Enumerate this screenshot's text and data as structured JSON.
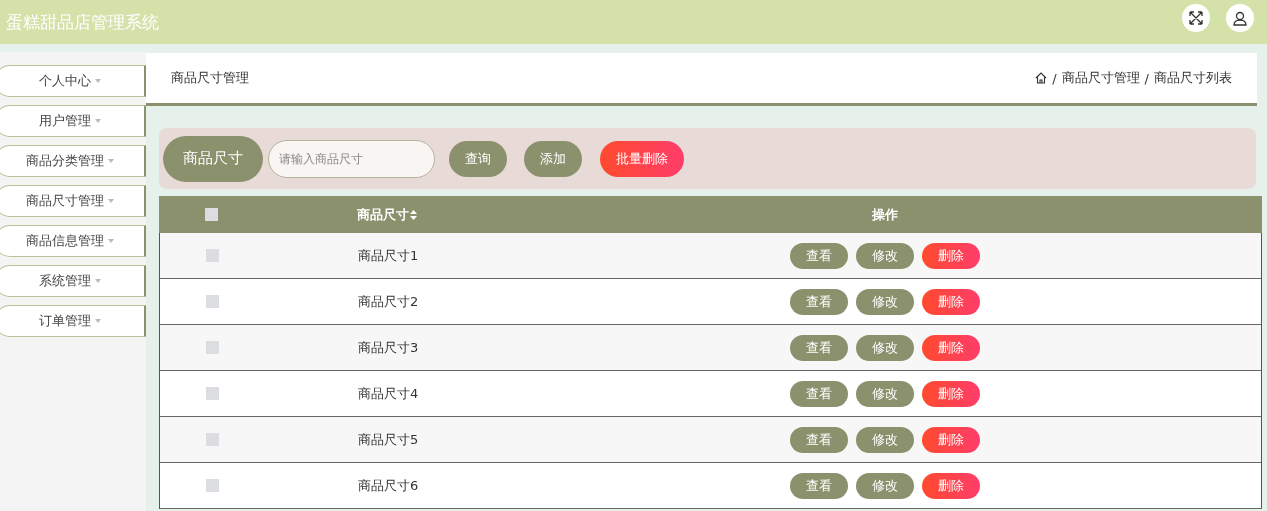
{
  "header": {
    "title": "蛋糕甜品店管理系统"
  },
  "sidebar": {
    "items": [
      {
        "label": "个人中心",
        "selected": false
      },
      {
        "label": "用户管理",
        "selected": false
      },
      {
        "label": "商品分类管理",
        "selected": false
      },
      {
        "label": "商品尺寸管理",
        "selected": false
      },
      {
        "label": "商品信息管理",
        "selected": false
      },
      {
        "label": "系统管理",
        "selected": false
      },
      {
        "label": "订单管理",
        "selected": false
      }
    ]
  },
  "page_title": "商品尺寸管理",
  "breadcrumb": [
    {
      "separator": "/",
      "label": "商品尺寸管理"
    },
    {
      "separator": "/",
      "label": "商品尺寸列表"
    }
  ],
  "search": {
    "label": "商品尺寸",
    "placeholder": "请输入商品尺寸",
    "buttons": [
      {
        "label": "查询",
        "kind": "normal"
      },
      {
        "label": "添加",
        "kind": "normal"
      },
      {
        "label": "批量删除",
        "kind": "danger"
      }
    ]
  },
  "table": {
    "select_all": {
      "checked": false
    },
    "columns": [
      "商品尺寸",
      "操作"
    ],
    "rows": [
      {
        "checked": false,
        "name": "商品尺寸1",
        "actions": [
          {
            "label": "查看",
            "kind": "normal"
          },
          {
            "label": "修改",
            "kind": "normal"
          },
          {
            "label": "删除",
            "kind": "danger"
          }
        ]
      },
      {
        "checked": false,
        "name": "商品尺寸2",
        "actions": [
          {
            "label": "查看",
            "kind": "normal"
          },
          {
            "label": "修改",
            "kind": "normal"
          },
          {
            "label": "删除",
            "kind": "danger"
          }
        ]
      },
      {
        "checked": false,
        "name": "商品尺寸3",
        "actions": [
          {
            "label": "查看",
            "kind": "normal"
          },
          {
            "label": "修改",
            "kind": "normal"
          },
          {
            "label": "删除",
            "kind": "danger"
          }
        ]
      },
      {
        "checked": false,
        "name": "商品尺寸4",
        "actions": [
          {
            "label": "查看",
            "kind": "normal"
          },
          {
            "label": "修改",
            "kind": "normal"
          },
          {
            "label": "删除",
            "kind": "danger"
          }
        ]
      },
      {
        "checked": false,
        "name": "商品尺寸5",
        "actions": [
          {
            "label": "查看",
            "kind": "normal"
          },
          {
            "label": "修改",
            "kind": "normal"
          },
          {
            "label": "删除",
            "kind": "danger"
          }
        ]
      },
      {
        "checked": false,
        "name": "商品尺寸6",
        "actions": [
          {
            "label": "查看",
            "kind": "normal"
          },
          {
            "label": "修改",
            "kind": "normal"
          },
          {
            "label": "删除",
            "kind": "danger"
          }
        ]
      }
    ]
  }
}
